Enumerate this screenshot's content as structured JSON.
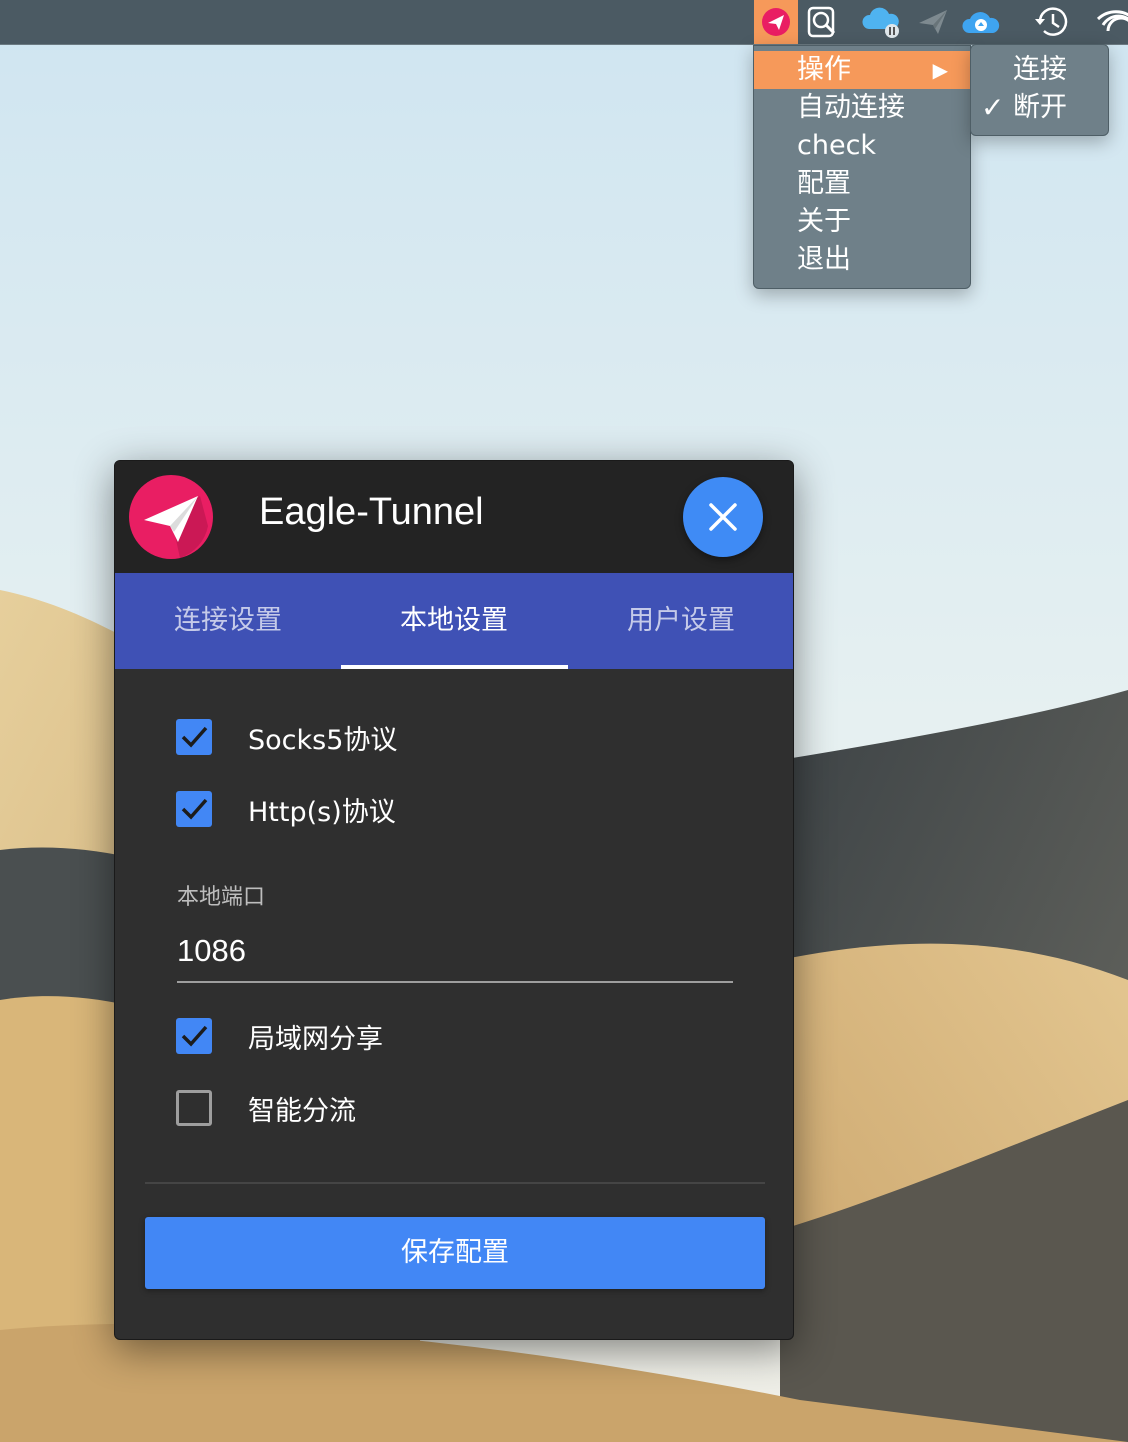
{
  "menubar": {
    "icons": [
      "eagle-tunnel-icon",
      "search-doc-icon",
      "cloud-paused-icon",
      "paper-plane-icon",
      "cloud-upload-icon",
      "time-machine-icon",
      "wifi-icon"
    ]
  },
  "tray_menu": {
    "items": [
      {
        "label": "操作",
        "submenu_arrow": "▶"
      },
      {
        "label": "自动连接"
      },
      {
        "label": "check"
      },
      {
        "label": "配置"
      },
      {
        "label": "关于"
      },
      {
        "label": "退出"
      }
    ],
    "submenu": {
      "items": [
        {
          "label": "连接",
          "checked": false
        },
        {
          "label": "断开",
          "checked": true,
          "check_mark": "✓"
        }
      ]
    }
  },
  "window": {
    "title": "Eagle-Tunnel",
    "tabs": [
      {
        "label": "连接设置"
      },
      {
        "label": "本地设置"
      },
      {
        "label": "用户设置"
      }
    ],
    "selected_tab": "本地设置",
    "options": {
      "socks5": {
        "label": "Socks5协议",
        "checked": true
      },
      "http": {
        "label": "Http(s)协议",
        "checked": true
      },
      "lan_share": {
        "label": "局域网分享",
        "checked": true
      },
      "smart_split": {
        "label": "智能分流",
        "checked": false
      }
    },
    "port": {
      "label": "本地端口",
      "value": "1086"
    },
    "save_label": "保存配置"
  },
  "colors": {
    "accent_blue": "#4287f5",
    "tab_bar": "#3f51b5",
    "menu_highlight": "#f6995a",
    "logo_pink": "#e91e63"
  }
}
